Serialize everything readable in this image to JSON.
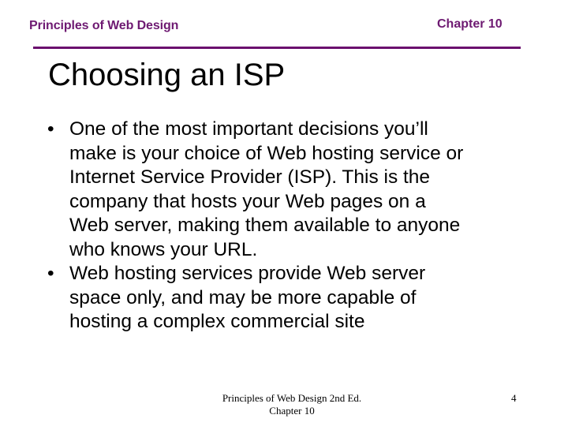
{
  "header": {
    "left": "Principles of Web Design",
    "right": "Chapter 10",
    "accent_color": "#6b0f6e"
  },
  "title": "Choosing an ISP",
  "bullets": [
    {
      "glyph": "•",
      "lines": [
        "One of the most important decisions you’ll",
        "make is your choice of Web hosting service or",
        "Internet Service Provider (ISP). This is the",
        "company that hosts your Web pages on a",
        "Web server, making them available to anyone",
        "who knows your URL."
      ]
    },
    {
      "glyph": "•",
      "lines": [
        "Web hosting services provide Web server",
        "space only, and may be more capable of",
        "hosting a complex commercial site"
      ]
    }
  ],
  "footer": {
    "line1": "Principles of Web Design 2nd Ed.",
    "line2": "Chapter 10",
    "page_number": "4"
  }
}
